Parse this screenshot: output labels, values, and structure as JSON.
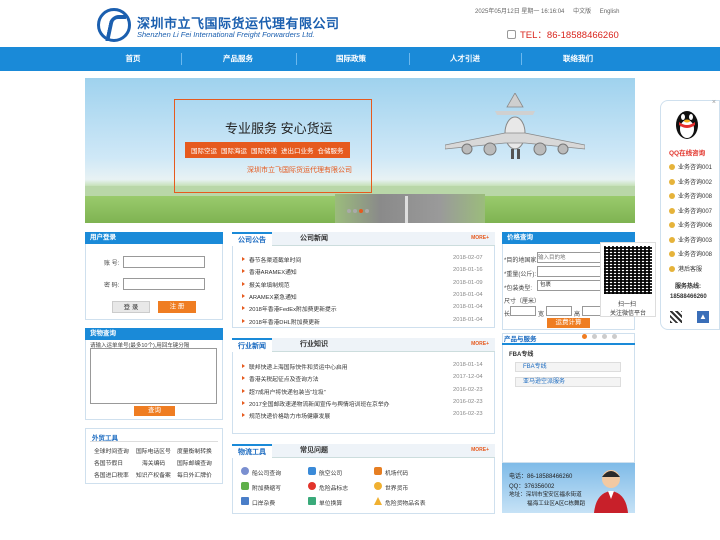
{
  "header": {
    "company_cn": "深圳市立飞国际货运代理有限公司",
    "company_en": "Shenzhen Li Fei International Freight Forwarders Ltd.",
    "datetime": "2025年05月12日 星期一 16:16:04",
    "lang_cn": "中文版",
    "lang_en": "English",
    "tel": "TEL：86-18588466260"
  },
  "nav": [
    "首页",
    "产品服务",
    "国际政策",
    "人才引进",
    "联络我们"
  ],
  "banner": {
    "slogan": "专业服务 安心货运",
    "tags": [
      "国际空运",
      "国际海运",
      "国际快递",
      "进出口业务",
      "仓储服务"
    ],
    "company": "深圳市立飞国际货运代理有限公司"
  },
  "login": {
    "title": "用户登录",
    "user_label": "账 号:",
    "pass_label": "密 码:",
    "login_btn": "登 录",
    "register_btn": "注 册"
  },
  "tracking": {
    "title": "货物查询",
    "hint": "请输入运单单号(最多10个),用回车键分隔",
    "btn": "查询"
  },
  "tools": {
    "title": "外贸工具",
    "items": [
      "全球时间查询",
      "国际电话区号",
      "度量衡制转换",
      "各国节假日",
      "海关编码",
      "国际邮编查询",
      "各国进口税率",
      "知识产权备案",
      "每日外汇牌价"
    ]
  },
  "news": {
    "tab1": "公司公告",
    "tab2": "公司新闻",
    "more": "MORE+",
    "items": [
      {
        "t": "春节各渠道截单时间",
        "d": "2018-02-07"
      },
      {
        "t": "香港ARAMEX通知",
        "d": "2018-01-16"
      },
      {
        "t": "报关单填制规范",
        "d": "2018-01-09"
      },
      {
        "t": "ARAMEX紧急通知",
        "d": "2018-01-04"
      },
      {
        "t": "2018年香港FedEx附加费更新提示",
        "d": "2018-01-04"
      },
      {
        "t": "2018年香港DHL附加费更新",
        "d": "2018-01-04"
      }
    ]
  },
  "industry": {
    "tab1": "行业新闻",
    "tab2": "行业知识",
    "more": "MORE+",
    "items": [
      {
        "t": "联邦快递上海国际快件和货运中心启用",
        "d": "2018-01-14"
      },
      {
        "t": "香港关税起征点及查询方法",
        "d": "2017-12-04"
      },
      {
        "t": "超7成用户将快递包装当“垃圾”",
        "d": "2016-02-23"
      },
      {
        "t": "2017全国邮政速递物流新闻宣传与舆情培训班在京举办",
        "d": "2016-02-23"
      },
      {
        "t": "规范快递价格助力市场健康发展",
        "d": "2016-02-23"
      }
    ]
  },
  "logistics": {
    "tab1": "物流工具",
    "tab2": "常见问题",
    "more": "MORE+",
    "items": [
      "船公司查询",
      "航空公司",
      "机场代码",
      "附加费缩写",
      "危险品标志",
      "世界货币",
      "口岸杂费",
      "单位换算",
      "危险货物品名表"
    ]
  },
  "price": {
    "title": "价格查询",
    "dest_label": "*目的地国家:",
    "dest_placeholder": "输入目的地",
    "weight_label": "*重量(公斤):",
    "pack_label": "*包装类型:",
    "pack_value": "包裹",
    "size_label": "尺寸（厘米）",
    "size_l": "长",
    "size_w": "宽",
    "size_h": "高",
    "btn": "运费计算"
  },
  "products": {
    "title": "产品与服务",
    "cat": "FBA专线",
    "items": [
      "FBA专线",
      "亚马逊空派服务"
    ]
  },
  "contact": {
    "tel": "电话：86-18588466260",
    "qq": "QQ：376356002",
    "addr1": "地址：深圳市宝安区福永街道",
    "addr2": "福海工业区A区C栋舞蹈"
  },
  "qq": {
    "title": "QQ在线咨询",
    "items": [
      "业务咨询001",
      "业务咨询002",
      "业务咨询008",
      "业务咨询007",
      "业务咨询006",
      "业务咨询003",
      "业务咨询008",
      "港后客服"
    ],
    "hotline_label": "服务热线:",
    "hotline": "18588466260"
  },
  "qrpop": {
    "line1": "扫一扫",
    "line2": "关注微信平台"
  }
}
